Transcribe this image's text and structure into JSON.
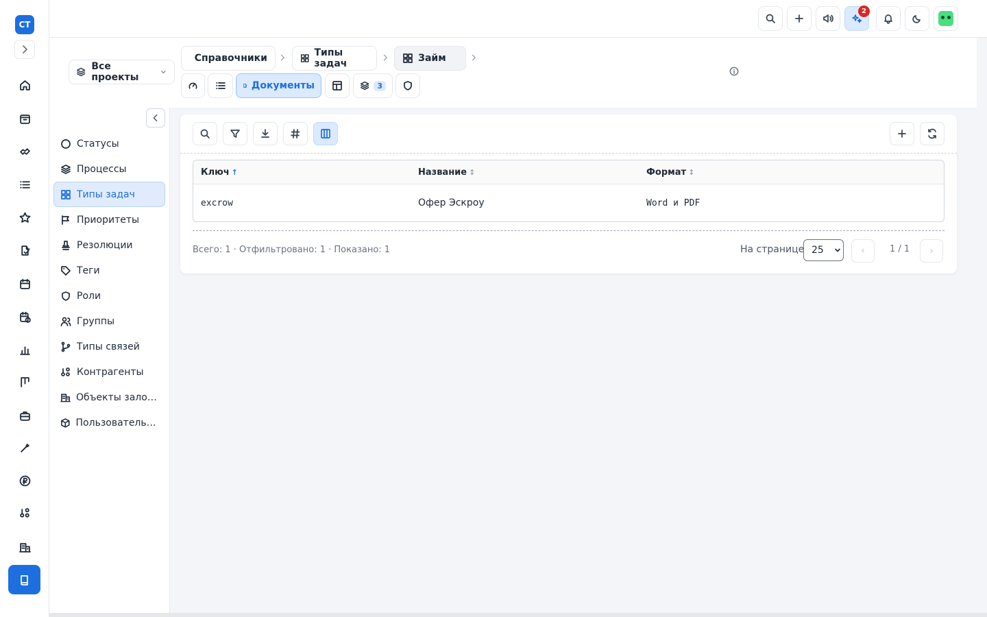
{
  "app": {
    "logo_text": "СТ"
  },
  "topbar": {
    "notifications_badge": "2"
  },
  "project_select": {
    "label": "Все проекты"
  },
  "breadcrumbs": [
    {
      "label": "Справочники"
    },
    {
      "label": "Типы задач"
    },
    {
      "label": "Займ"
    }
  ],
  "toolbar": {
    "documents_label": "Документы",
    "layers_count": "3"
  },
  "sidebar": {
    "items": [
      {
        "label": "Статусы"
      },
      {
        "label": "Процессы"
      },
      {
        "label": "Типы задач"
      },
      {
        "label": "Приоритеты"
      },
      {
        "label": "Резолюции"
      },
      {
        "label": "Теги"
      },
      {
        "label": "Роли"
      },
      {
        "label": "Группы"
      },
      {
        "label": "Типы связей"
      },
      {
        "label": "Контрагенты"
      },
      {
        "label": "Объекты залогов"
      },
      {
        "label": "Пользовательск..."
      }
    ],
    "selected_index": 2
  },
  "table": {
    "columns": [
      {
        "label": "Ключ",
        "sort": "asc"
      },
      {
        "label": "Название",
        "sort": "none"
      },
      {
        "label": "Формат",
        "sort": "none"
      }
    ],
    "rows": [
      {
        "key": "excrow",
        "name": "Офер Эскроу",
        "format": "Word и PDF"
      }
    ]
  },
  "footer": {
    "summary": "Всего: 1 · Отфильтровано: 1 · Показано: 1",
    "per_page_label": "На странице",
    "per_page_value": "25",
    "page_indicator": "1 / 1",
    "prev_glyph": "‹",
    "next_glyph": "›"
  },
  "colors": {
    "accent": "#1d6fe0",
    "badge": "#dc2626",
    "selected_bg": "#e0ecfd"
  }
}
